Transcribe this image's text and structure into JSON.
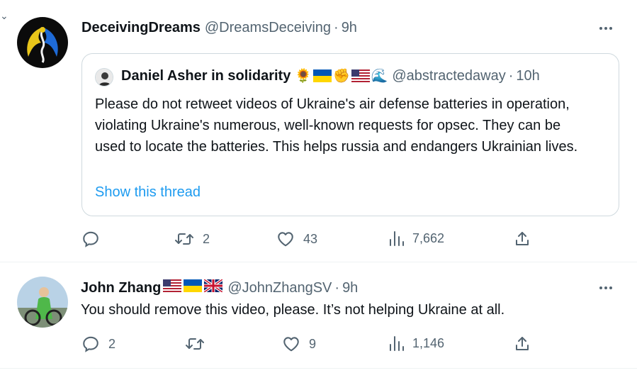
{
  "tweet1": {
    "name": "DeceivingDreams",
    "handle": "@DreamsDeceiving",
    "separator": "·",
    "time": "9h",
    "quote": {
      "name": "Daniel Asher in solidarity",
      "emoji_sunflower": "🌻",
      "emoji_fist": "✊",
      "emoji_wave": "🌊",
      "handle": "@abstractedaway",
      "separator": "·",
      "time": "10h",
      "text": "Please do not retweet videos of Ukraine's air defense batteries in operation, violating Ukraine's numerous, well-known requests for opsec.  They can be used to locate the batteries.  This helps russia and endangers Ukrainian lives.",
      "show_thread": "Show this thread"
    },
    "actions": {
      "replies": "",
      "retweets": "2",
      "likes": "43",
      "views": "7,662"
    }
  },
  "tweet2": {
    "name": "John Zhang",
    "handle": "@JohnZhangSV",
    "separator": "·",
    "time": "9h",
    "text": "You should remove this video, please.  It’s not helping Ukraine at all.",
    "actions": {
      "replies": "2",
      "retweets": "",
      "likes": "9",
      "views": "1,146"
    }
  },
  "icons": {
    "reply": "reply-icon",
    "retweet": "retweet-icon",
    "like": "heart-icon",
    "views": "views-icon",
    "share": "share-icon",
    "more": "more-icon"
  },
  "colors": {
    "link": "#1d9bf0",
    "secondary_text": "#536471",
    "border": "#cfd9de"
  }
}
